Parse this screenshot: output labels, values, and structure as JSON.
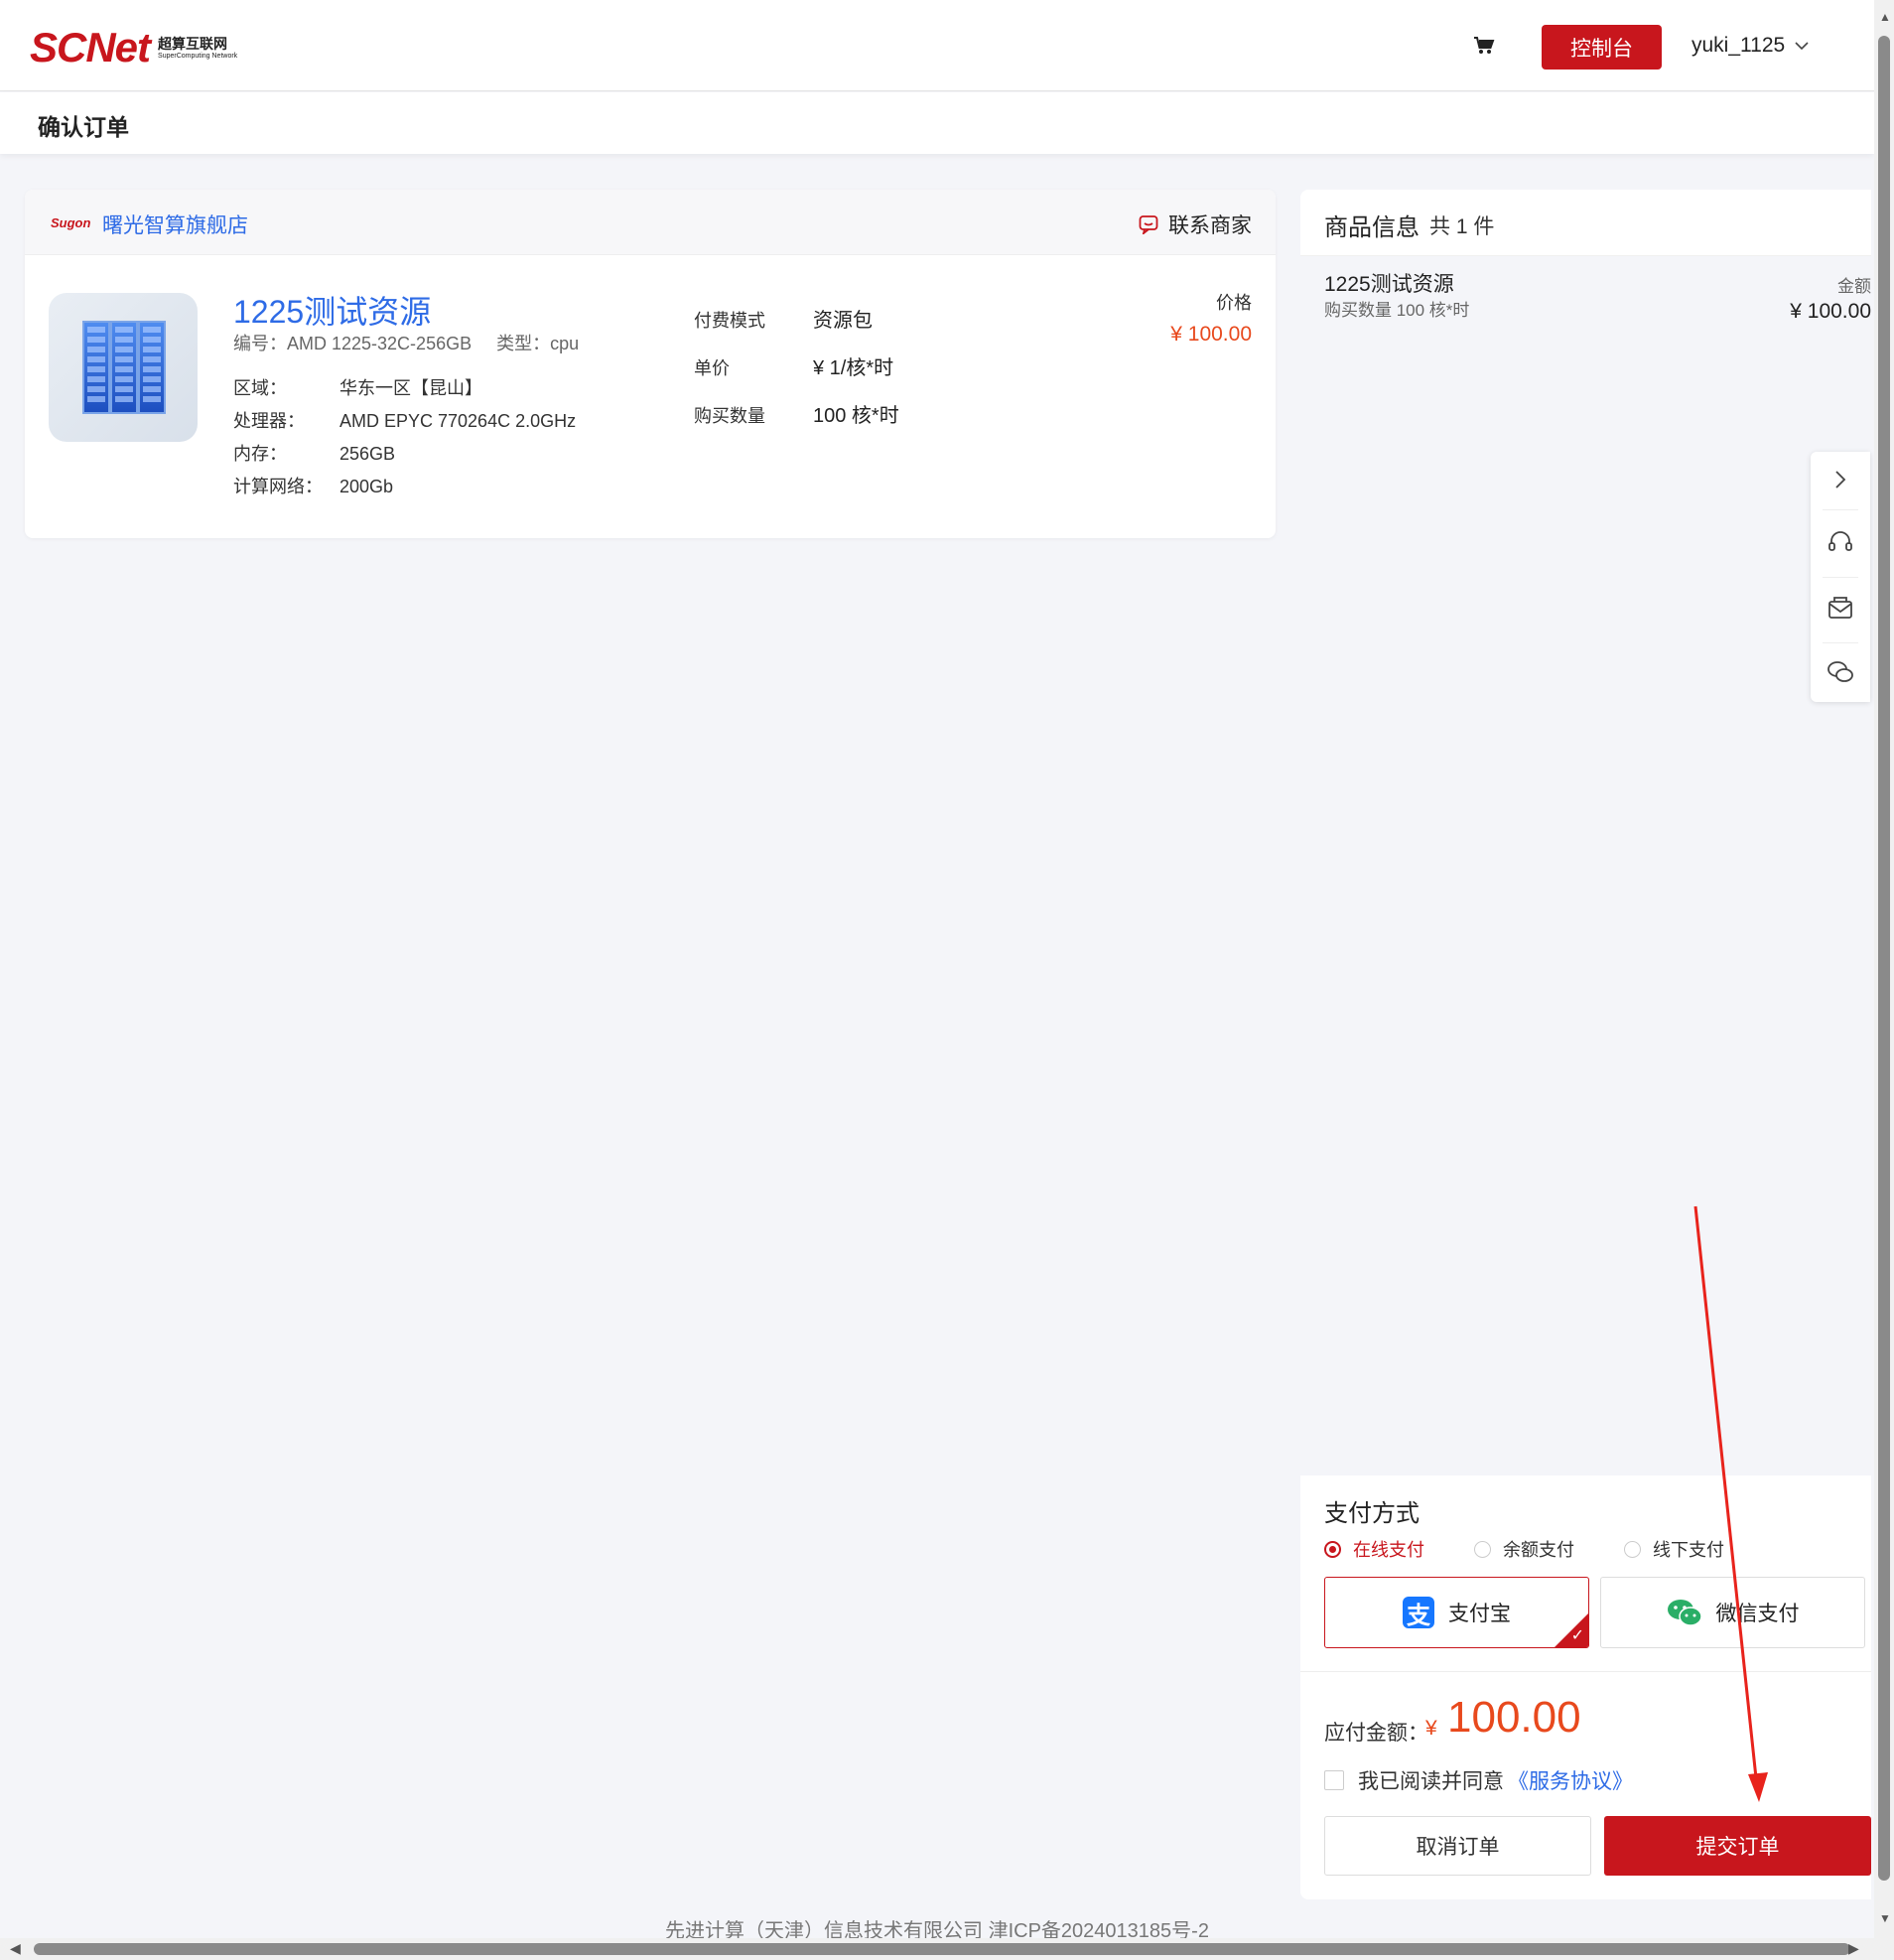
{
  "header": {
    "logo_main": "SCNet",
    "logo_sub_cn": "超算互联网",
    "logo_sub_en": "SuperComputing Network",
    "console_label": "控制台",
    "username": "yuki_1125"
  },
  "page": {
    "title": "确认订单"
  },
  "shop": {
    "logo_text": "Sugon",
    "name": "曙光智算旗舰店",
    "contact_label": "联系商家"
  },
  "product": {
    "name": "1225测试资源",
    "code_label": "编号：",
    "code": "AMD 1225-32C-256GB",
    "type_label": "类型：",
    "type": "cpu",
    "specs": [
      {
        "key": "区域：",
        "value": "华东一区【昆山】"
      },
      {
        "key": "处理器：",
        "value": "AMD EPYC 770264C 2.0GHz"
      },
      {
        "key": "内存：",
        "value": "256GB"
      },
      {
        "key": "计算网络：",
        "value": "200Gb"
      }
    ],
    "billing": [
      {
        "key": "付费模式",
        "value": "资源包"
      },
      {
        "key": "单价",
        "value": "¥ 1/核*时"
      },
      {
        "key": "购买数量",
        "value": "100 核*时"
      }
    ],
    "price_label": "价格",
    "price": "¥ 100.00"
  },
  "summary": {
    "title": "商品信息",
    "count": "共 1 件",
    "item_name": "1225测试资源",
    "item_qty": "购买数量 100 核*时",
    "amount_label": "金额",
    "amount": "¥ 100.00"
  },
  "payment": {
    "title": "支付方式",
    "options": [
      "在线支付",
      "余额支付",
      "线下支付"
    ],
    "selected_option": "在线支付",
    "methods": [
      "支付宝",
      "微信支付"
    ],
    "selected_method": "支付宝",
    "due_label": "应付金额：",
    "due_currency": "¥",
    "due_amount": "100.00",
    "agree_text": "我已阅读并同意",
    "agree_link": "《服务协议》",
    "cancel_label": "取消订单",
    "submit_label": "提交订单"
  },
  "float_tools": [
    "chevron-right-icon",
    "headset-icon",
    "mail-icon",
    "wechat-icon"
  ],
  "footer": {
    "text": "先进计算（天津）信息技术有限公司 津ICP备2024013185号-2"
  },
  "colors": {
    "brand_red": "#c8161d",
    "link_blue": "#2e6be6",
    "price_orange": "#e8491d",
    "annotation_arrow": "#e8231c"
  }
}
